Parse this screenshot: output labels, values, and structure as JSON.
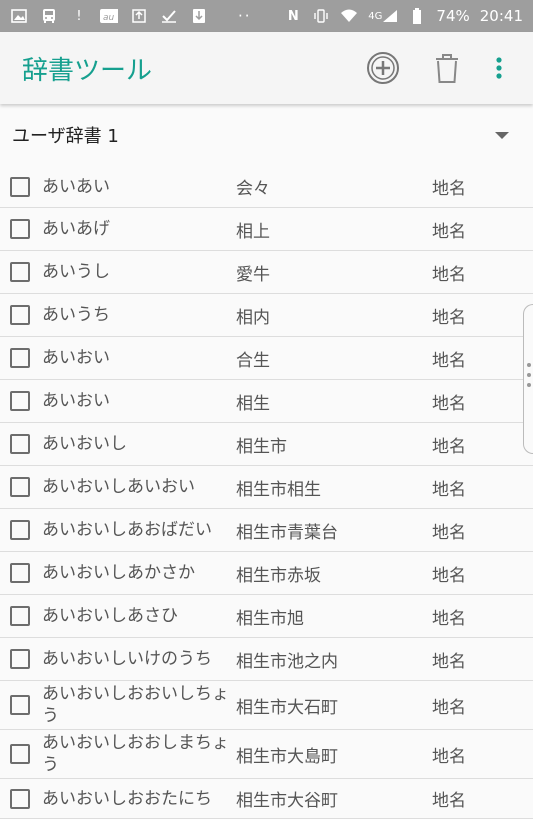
{
  "status_bar": {
    "icons": [
      "image-icon",
      "bus-icon",
      "au-icon",
      "upload-icon",
      "check-icon",
      "download-icon"
    ],
    "more": "··",
    "battery": "74%",
    "time": "20:41",
    "network": "4G"
  },
  "app_bar": {
    "title": "辞書ツール",
    "actions": [
      "add-icon",
      "trash-icon",
      "more-vert-icon"
    ]
  },
  "dictionary_selector": {
    "selected": "ユーザ辞書 1"
  },
  "entries": [
    {
      "reading": "あいあい",
      "word": "会々",
      "pos": "地名"
    },
    {
      "reading": "あいあげ",
      "word": "相上",
      "pos": "地名"
    },
    {
      "reading": "あいうし",
      "word": "愛牛",
      "pos": "地名"
    },
    {
      "reading": "あいうち",
      "word": "相内",
      "pos": "地名"
    },
    {
      "reading": "あいおい",
      "word": "合生",
      "pos": "地名"
    },
    {
      "reading": "あいおい",
      "word": "相生",
      "pos": "地名"
    },
    {
      "reading": "あいおいし",
      "word": "相生市",
      "pos": "地名"
    },
    {
      "reading": "あいおいしあいおい",
      "word": "相生市相生",
      "pos": "地名"
    },
    {
      "reading": "あいおいしあおばだい",
      "word": "相生市青葉台",
      "pos": "地名"
    },
    {
      "reading": "あいおいしあかさか",
      "word": "相生市赤坂",
      "pos": "地名"
    },
    {
      "reading": "あいおいしあさひ",
      "word": "相生市旭",
      "pos": "地名"
    },
    {
      "reading": "あいおいしいけのうち",
      "word": "相生市池之内",
      "pos": "地名"
    },
    {
      "reading": "あいおいしおおいしちょう",
      "word": "相生市大石町",
      "pos": "地名"
    },
    {
      "reading": "あいおいしおおしまちょう",
      "word": "相生市大島町",
      "pos": "地名"
    },
    {
      "reading": "あいおいしおおたにち",
      "word": "相生市大谷町",
      "pos": "地名"
    }
  ],
  "colors": {
    "accent": "#16a08f",
    "status_bar": "#9e9e9e"
  }
}
